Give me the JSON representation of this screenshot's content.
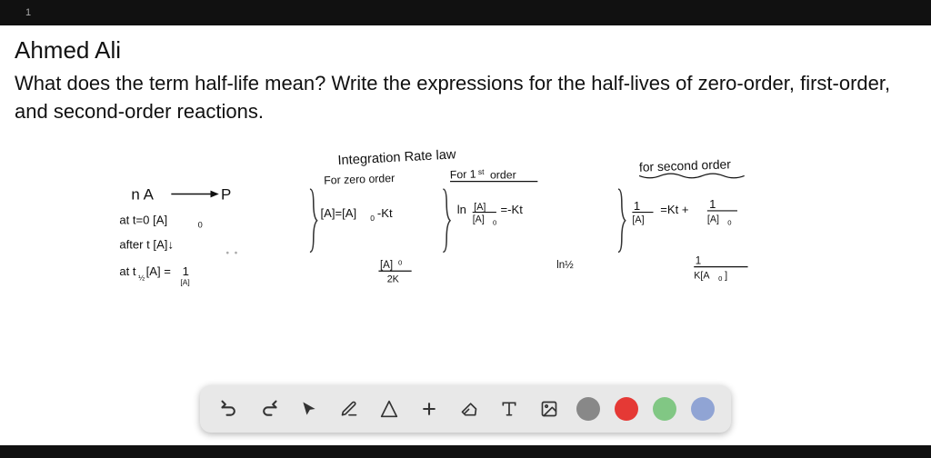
{
  "page": {
    "number": "1",
    "background": "#ffffff"
  },
  "document": {
    "author": "Ahmed Ali",
    "question": "What does the term half-life mean? Write the expressions for the half-lives of zero-order, first-order, and second-order reactions."
  },
  "toolbar": {
    "buttons": [
      {
        "name": "undo",
        "label": "↩",
        "icon": "undo-icon"
      },
      {
        "name": "redo",
        "label": "↪",
        "icon": "redo-icon"
      },
      {
        "name": "select",
        "label": "▲",
        "icon": "cursor-icon"
      },
      {
        "name": "pen",
        "label": "✏",
        "icon": "pen-icon"
      },
      {
        "name": "shapes",
        "label": "△",
        "icon": "shapes-icon"
      },
      {
        "name": "add",
        "label": "+",
        "icon": "add-icon"
      },
      {
        "name": "eraser",
        "label": "◻",
        "icon": "eraser-icon"
      },
      {
        "name": "text",
        "label": "A",
        "icon": "text-icon"
      },
      {
        "name": "image",
        "label": "🖼",
        "icon": "image-icon"
      }
    ],
    "colors": [
      {
        "name": "gray",
        "value": "#888888"
      },
      {
        "name": "red",
        "value": "#e53935"
      },
      {
        "name": "green",
        "value": "#81c784"
      },
      {
        "name": "blue",
        "value": "#90a4d4"
      }
    ]
  }
}
